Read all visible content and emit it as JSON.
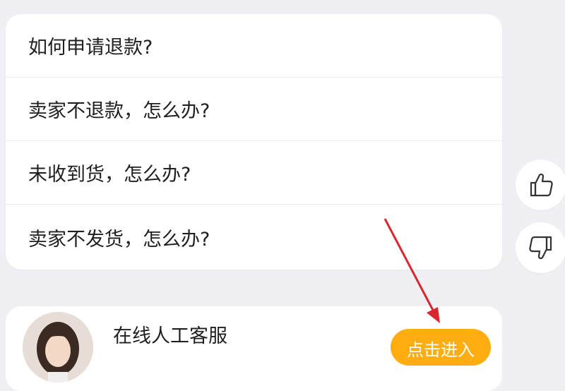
{
  "faq": {
    "items": [
      {
        "label": "如何申请退款?"
      },
      {
        "label": "卖家不退款，怎么办?"
      },
      {
        "label": "未收到货，怎么办?"
      },
      {
        "label": "卖家不发货，怎么办?"
      }
    ]
  },
  "feedback": {
    "like_icon": "thumbs-up-icon",
    "dislike_icon": "thumbs-down-icon"
  },
  "service": {
    "title": "在线人工客服",
    "button_label": "点击进入",
    "button_color": "#ffad10"
  },
  "annotation": {
    "arrow_color": "#d9272e"
  }
}
